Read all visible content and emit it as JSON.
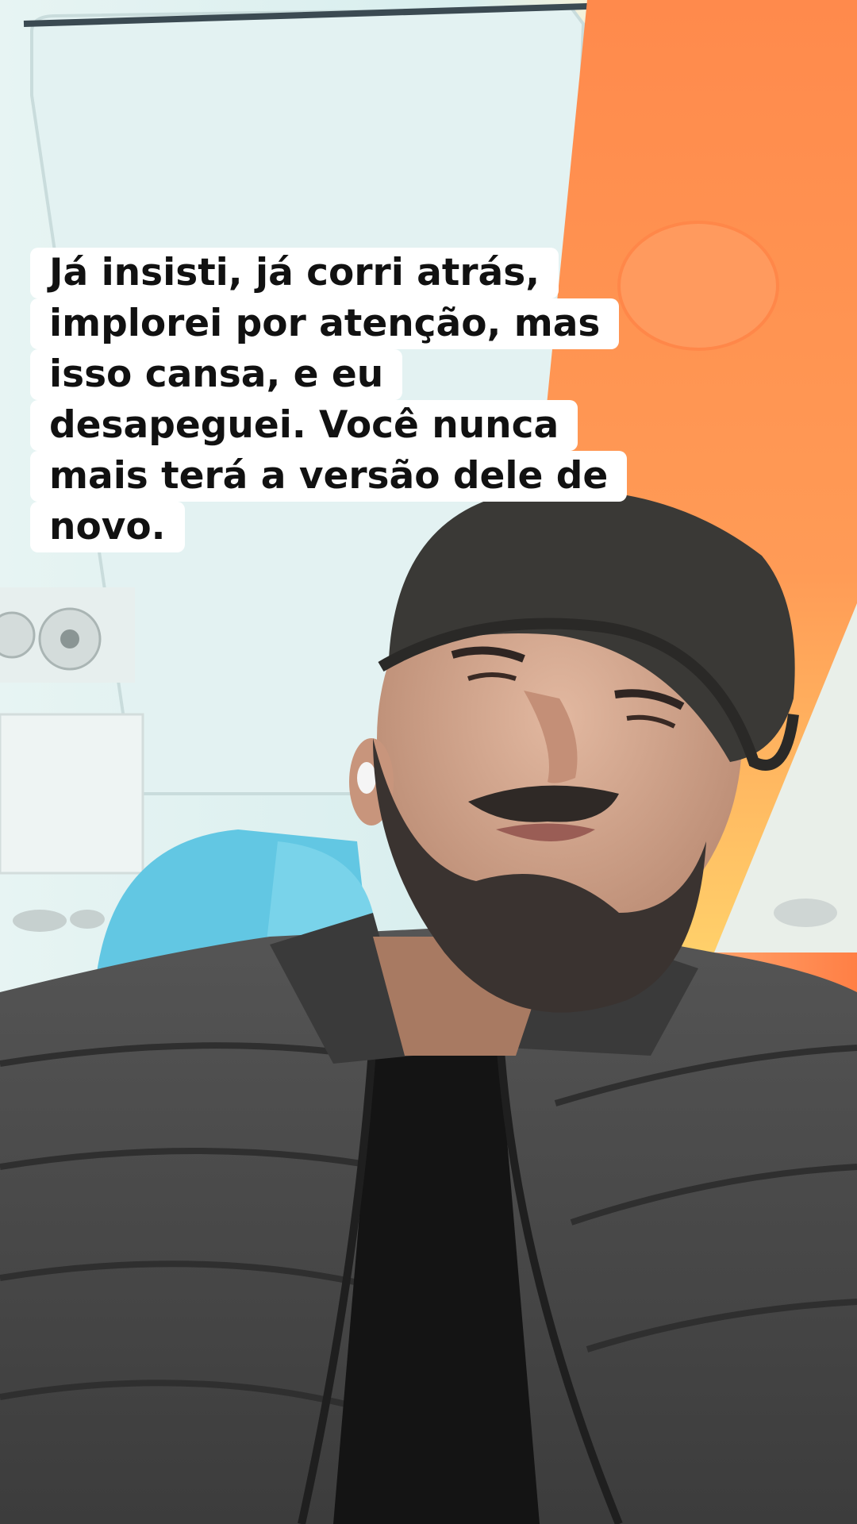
{
  "caption": {
    "lines": [
      "Já insisti, já corri atrás,",
      "implorei por atenção, mas",
      "isso cansa, e eu",
      "desapeguei. Você nunca",
      "mais terá a versão dele de",
      "novo."
    ]
  },
  "photo": {
    "subject": "selfie-man-cap-beard-puffer-jacket",
    "setting": "airplane-cabin",
    "colors": {
      "ceiling": "#d9eef0",
      "ceiling_light": "#eef8f8",
      "orange_glow": "#ff8a4a",
      "seat_blue": "#5ec8e6",
      "jacket": "#4a4a4a",
      "jacket_dark": "#2e2e2e",
      "cap": "#3a3936",
      "skin": "#d6a98f",
      "beard": "#3a3330",
      "shirt": "#141414"
    }
  }
}
